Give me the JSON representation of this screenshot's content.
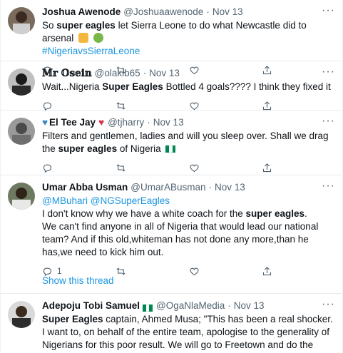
{
  "tweets": [
    {
      "name": "Joshua Awenode",
      "handle": "@Joshuaawenode",
      "time": "Nov 13",
      "text_parts": [
        "So ",
        "super eagles",
        " let Sierra Leone to do what Newcastle did to arsenal"
      ],
      "hashtag": "#NigeriavsSierraLeone"
    },
    {
      "name": "𝕄𝕣 𝕆𝕤𝕖𝕚𝕟",
      "handle": "@olakib65",
      "time": "Nov 13",
      "text_parts": [
        "Wait...Nigeria ",
        "Super Eagles",
        " Bottled 4 goals???? I think they fixed it"
      ]
    },
    {
      "name": "El Tee Jay",
      "handle": "@tjharry",
      "time": "Nov 13",
      "text_parts": [
        "Filters and gentlemen, ladies and will you sleep over. Shall we drag the ",
        "super eagles",
        " of Nigeria"
      ]
    },
    {
      "name": "Umar Abba Usman",
      "handle": "@UmarABusman",
      "time": "Nov 13",
      "mentions": [
        "@MBuhari",
        "@NGSuperEagles"
      ],
      "text_parts": [
        "I don't know why we have a white coach for the ",
        "super eagles",
        ".",
        "We can't find anyone in all of Nigeria that would lead our national team? And if this old,whiteman has not done any more,than he has,we need to kick him out."
      ],
      "reply_count": "1",
      "show_thread": "Show this thread"
    },
    {
      "name": "Adepoju Tobi Samuel",
      "handle": "@OgaNlaMedia",
      "time": "Nov 13",
      "text_parts": [
        "Super Eagles",
        " captain, Ahmed Musa; \"This has been a real shocker. I want to, on behalf of the entire team, apologise to the generality of Nigerians for this poor result. We will go to Freetown and do the needful.\""
      ]
    }
  ],
  "separator": "·",
  "more_glyph": "···"
}
